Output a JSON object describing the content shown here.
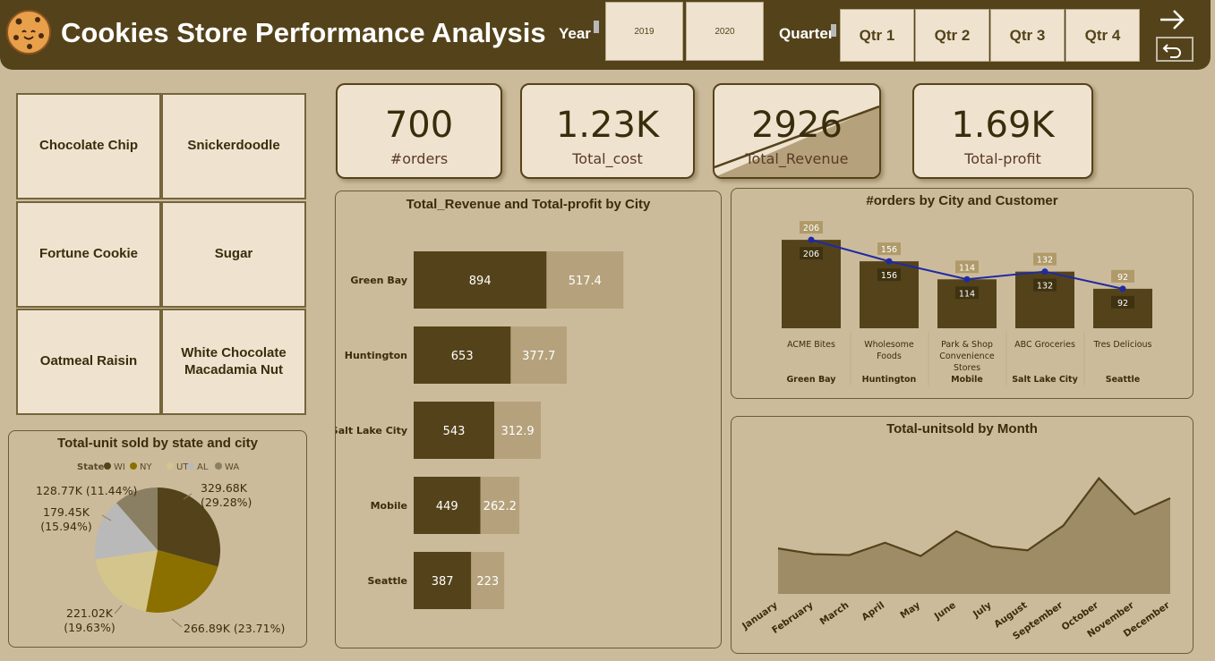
{
  "header": {
    "title": "Cookies Store Performance Analysis",
    "year_label": "Year",
    "years": [
      "2019",
      "2020"
    ],
    "quarter_label": "Quarter",
    "quarters": [
      "Qtr 1",
      "Qtr 2",
      "Qtr 3",
      "Qtr 4"
    ]
  },
  "products": [
    "Chocolate Chip",
    "Snickerdoodle",
    "Fortune Cookie",
    "Sugar",
    "Oatmeal Raisin",
    "White Chocolate Macadamia Nut"
  ],
  "kpis": [
    {
      "value": "700",
      "label": "#orders"
    },
    {
      "value": "1.23K",
      "label": "Total_cost"
    },
    {
      "value": "2926",
      "label": "Total_Revenue"
    },
    {
      "value": "1.69K",
      "label": "Total-profit"
    }
  ],
  "colors": {
    "dark_brown": "#54431a",
    "tan": "#b5a27c",
    "background": "#ccbb9b",
    "card": "#efe3d0",
    "line_blue": "#1f2aa5"
  },
  "chart_data": [
    {
      "type": "bar",
      "orientation": "horizontal",
      "stacked": true,
      "title": "Total_Revenue and Total-profit by City",
      "categories": [
        "Green Bay",
        "Huntington",
        "Salt Lake City",
        "Mobile",
        "Seattle"
      ],
      "series": [
        {
          "name": "Total_Revenue",
          "values": [
            894,
            653,
            543,
            449,
            387
          ],
          "labels": [
            "894",
            "653",
            "543",
            "449",
            "387"
          ]
        },
        {
          "name": "Total-profit",
          "values": [
            517.4,
            377.7,
            312.9,
            262.2,
            223
          ],
          "labels": [
            "517.4",
            "377.7",
            "312.9",
            "262.2",
            "223"
          ]
        }
      ]
    },
    {
      "type": "bar",
      "title": "#orders by City and Customer",
      "customers": [
        "ACME Bites",
        "Wholesome Foods",
        "Park & Shop Convenience Stores",
        "ABC Groceries",
        "Tres Delicious"
      ],
      "cities": [
        "Green Bay",
        "Huntington",
        "Mobile",
        "Salt Lake City",
        "Seattle"
      ],
      "values": [
        206,
        156,
        114,
        132,
        92
      ],
      "labels": [
        "206",
        "156",
        "114",
        "132",
        "92"
      ],
      "line_overlay": true
    },
    {
      "type": "area",
      "title": "Total-unitsold by Month",
      "categories": [
        "January",
        "February",
        "March",
        "April",
        "May",
        "June",
        "July",
        "August",
        "September",
        "October",
        "November",
        "December"
      ],
      "values": [
        48,
        42,
        41,
        54,
        40,
        66,
        50,
        46,
        72,
        122,
        84,
        101
      ],
      "ylim": [
        0,
        130
      ]
    },
    {
      "type": "pie",
      "title": "Total-unit sold by state and city",
      "legend_title": "State",
      "legend_position": "top",
      "categories": [
        "WI",
        "NY",
        "UT",
        "AL",
        "WA"
      ],
      "values": [
        329.68,
        266.89,
        221.02,
        179.45,
        128.77
      ],
      "unit": "K",
      "labels": [
        "329.68K (29.28%)",
        "266.89K (23.71%)",
        "221.02K (19.63%)",
        "179.45K (15.94%)",
        "128.77K (11.44%)"
      ],
      "colors": [
        "#54431a",
        "#8b7000",
        "#d4c58d",
        "#b9b9b9",
        "#8a7f63"
      ]
    }
  ]
}
